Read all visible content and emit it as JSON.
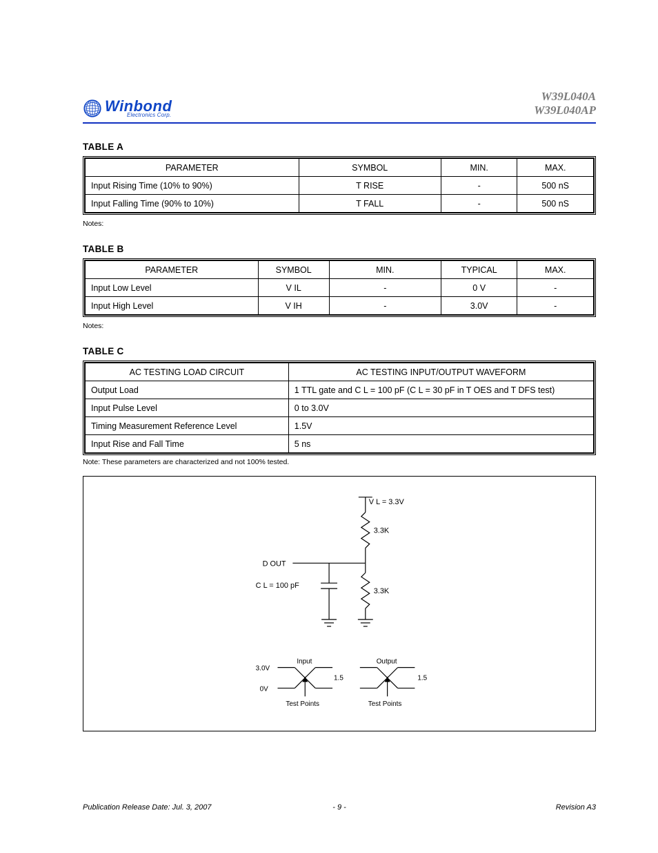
{
  "header": {
    "logo_name": "Winbond",
    "logo_sub": "Electronics Corp.",
    "part_line1": "W39L040A",
    "part_line2": "W39L040AP"
  },
  "tableA": {
    "title": "TABLE A",
    "cols": [
      "PARAMETER",
      "SYMBOL",
      "MIN.",
      "MAX."
    ],
    "rows": [
      [
        "Input Rising Time (10% to 90%)",
        "T RISE",
        "-",
        "500 nS"
      ],
      [
        "Input Falling Time (90% to 10%)",
        "T FALL",
        "-",
        "500 nS"
      ]
    ]
  },
  "tableB": {
    "title": "TABLE B",
    "cols": [
      "PARAMETER",
      "SYMBOL",
      "MIN.",
      "TYPICAL",
      "MAX."
    ],
    "rows": [
      [
        "Input Low Level",
        "V IL",
        "-",
        "0 V",
        "-"
      ],
      [
        "Input High Level",
        "V IH",
        "-",
        "3.0V",
        "-"
      ]
    ]
  },
  "tableC": {
    "title": "TABLE C",
    "cols": [
      "AC TESTING LOAD CIRCUIT",
      "AC TESTING INPUT/OUTPUT WAVEFORM"
    ],
    "rows": [
      [
        "Output Load",
        "1 TTL gate and C L = 100 pF (C L = 30 pF in T OES and T DFS test)"
      ],
      [
        "Input Pulse Level",
        "0 to 3.0V"
      ],
      [
        "Timing Measurement Reference Level",
        "1.5V"
      ],
      [
        "Input Rise and Fall Time",
        "5 ns"
      ]
    ],
    "note": "Note: These parameters are characterized and not 100% tested."
  },
  "diagram": {
    "vl": "V L = 3.3V",
    "r1": "3.3K",
    "r2": "3.3K",
    "dout": "D OUT",
    "cl": "C L = 100 pF",
    "vhi": "3.0V",
    "vlo": "0V",
    "ref": "1.5",
    "tp_in": "Test Points",
    "tp_out": "Test Points",
    "in": "Input",
    "out": "Output"
  },
  "footer": {
    "left": "Publication Release Date: Jul. 3, 2007",
    "center": "- 9 -",
    "right": "Revision A3"
  }
}
